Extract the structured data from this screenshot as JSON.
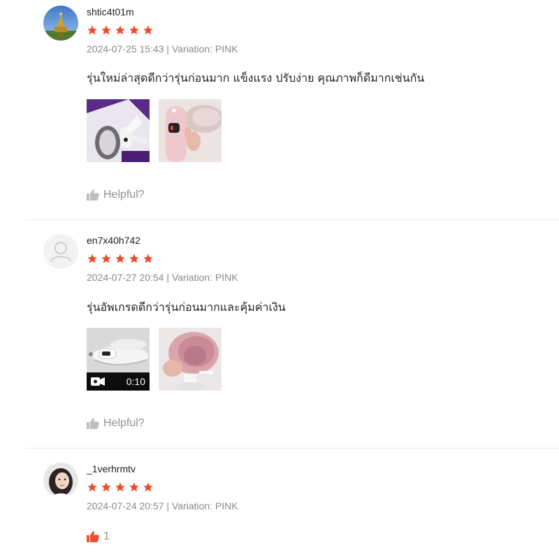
{
  "colors": {
    "star": "#ee4d2d",
    "helpful_active": "#ee4d2d",
    "meta": "#8a8a8a"
  },
  "reviews": [
    {
      "username": "shtic4t01m",
      "rating": 5,
      "meta": "2024-07-25 15:43 | Variation: PINK",
      "content": "รุ่นใหม่ล่าสุดดีกว่ารุ่นก่อนมาก แข็งแรง ปรับง่าย คุณภาพก็ดีมากเช่นกัน",
      "helpful_label": "Helpful?"
    },
    {
      "username": "en7x40h742",
      "rating": 5,
      "meta": "2024-07-27 20:54 | Variation: PINK",
      "content": "รุ่นอัพเกรดดีกว่ารุ่นก่อนมากและคุ้มค่าเงิน",
      "video_duration": "0:10",
      "helpful_label": "Helpful?"
    },
    {
      "username": "_1verhrmtv",
      "rating": 5,
      "meta": "2024-07-24 20:57 | Variation: PINK",
      "helpful_count": "1"
    }
  ]
}
